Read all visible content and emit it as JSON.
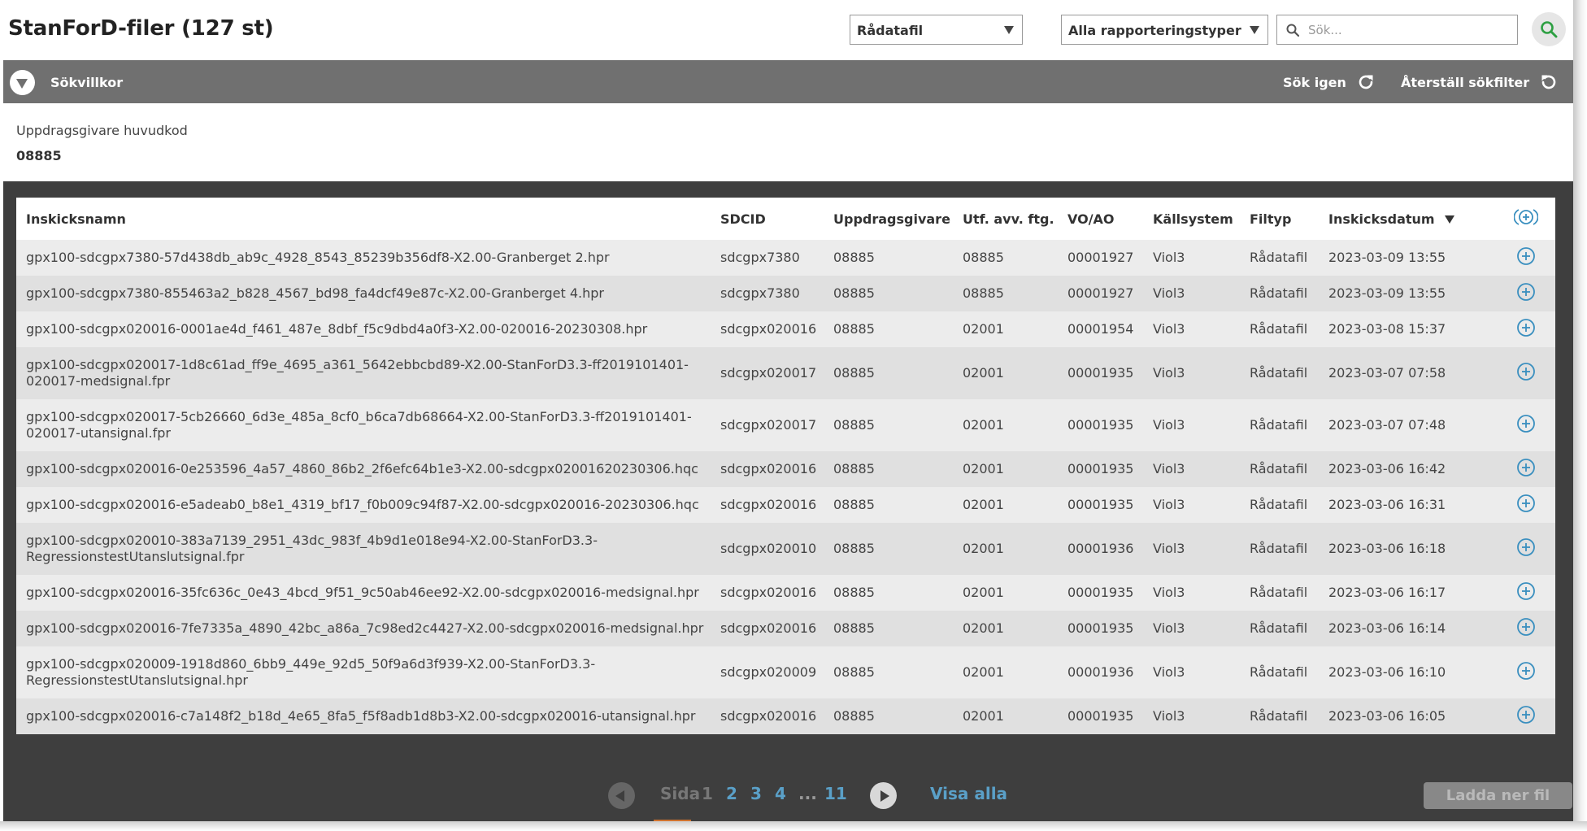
{
  "header": {
    "title": "StanForD-filer (127 st)",
    "file_type_select": "Rådatafil",
    "report_type_select": "Alla rapporteringstyper",
    "search_placeholder": "Sök..."
  },
  "filter_bar": {
    "label": "Sökvillkor",
    "redo_label": "Sök igen",
    "reset_label": "Återställ sökfilter"
  },
  "criteria": {
    "label": "Uppdragsgivare huvudkod",
    "value": "08885"
  },
  "table": {
    "columns": [
      "Inskicksnamn",
      "SDCID",
      "Uppdragsgivare",
      "Utf. avv. ftg.",
      "VO/AO",
      "Källsystem",
      "Filtyp",
      "Inskicksdatum"
    ],
    "rows": [
      {
        "name": "gpx100-sdcgpx7380-57d438db_ab9c_4928_8543_85239b356df8-X2.00-Granberget 2.hpr",
        "sdcid": "sdcgpx7380",
        "client": "08885",
        "exec": "08885",
        "voao": "00001927",
        "source": "Viol3",
        "filetype": "Rådatafil",
        "date": "2023-03-09 13:55"
      },
      {
        "name": "gpx100-sdcgpx7380-855463a2_b828_4567_bd98_fa4dcf49e87c-X2.00-Granberget 4.hpr",
        "sdcid": "sdcgpx7380",
        "client": "08885",
        "exec": "08885",
        "voao": "00001927",
        "source": "Viol3",
        "filetype": "Rådatafil",
        "date": "2023-03-09 13:55"
      },
      {
        "name": "gpx100-sdcgpx020016-0001ae4d_f461_487e_8dbf_f5c9dbd4a0f3-X2.00-020016-20230308.hpr",
        "sdcid": "sdcgpx020016",
        "client": "08885",
        "exec": "02001",
        "voao": "00001954",
        "source": "Viol3",
        "filetype": "Rådatafil",
        "date": "2023-03-08 15:37"
      },
      {
        "name": "gpx100-sdcgpx020017-1d8c61ad_ff9e_4695_a361_5642ebbcbd89-X2.00-StanForD3.3-ff2019101401-020017-medsignal.fpr",
        "sdcid": "sdcgpx020017",
        "client": "08885",
        "exec": "02001",
        "voao": "00001935",
        "source": "Viol3",
        "filetype": "Rådatafil",
        "date": "2023-03-07 07:58"
      },
      {
        "name": "gpx100-sdcgpx020017-5cb26660_6d3e_485a_8cf0_b6ca7db68664-X2.00-StanForD3.3-ff2019101401-020017-utansignal.fpr",
        "sdcid": "sdcgpx020017",
        "client": "08885",
        "exec": "02001",
        "voao": "00001935",
        "source": "Viol3",
        "filetype": "Rådatafil",
        "date": "2023-03-07 07:48"
      },
      {
        "name": "gpx100-sdcgpx020016-0e253596_4a57_4860_86b2_2f6efc64b1e3-X2.00-sdcgpx02001620230306.hqc",
        "sdcid": "sdcgpx020016",
        "client": "08885",
        "exec": "02001",
        "voao": "00001935",
        "source": "Viol3",
        "filetype": "Rådatafil",
        "date": "2023-03-06 16:42"
      },
      {
        "name": "gpx100-sdcgpx020016-e5adeab0_b8e1_4319_bf17_f0b009c94f87-X2.00-sdcgpx020016-20230306.hqc",
        "sdcid": "sdcgpx020016",
        "client": "08885",
        "exec": "02001",
        "voao": "00001935",
        "source": "Viol3",
        "filetype": "Rådatafil",
        "date": "2023-03-06 16:31"
      },
      {
        "name": "gpx100-sdcgpx020010-383a7139_2951_43dc_983f_4b9d1e018e94-X2.00-StanForD3.3-RegressionstestUtanslutsignal.fpr",
        "sdcid": "sdcgpx020010",
        "client": "08885",
        "exec": "02001",
        "voao": "00001936",
        "source": "Viol3",
        "filetype": "Rådatafil",
        "date": "2023-03-06 16:18"
      },
      {
        "name": "gpx100-sdcgpx020016-35fc636c_0e43_4bcd_9f51_9c50ab46ee92-X2.00-sdcgpx020016-medsignal.hpr",
        "sdcid": "sdcgpx020016",
        "client": "08885",
        "exec": "02001",
        "voao": "00001935",
        "source": "Viol3",
        "filetype": "Rådatafil",
        "date": "2023-03-06 16:17"
      },
      {
        "name": "gpx100-sdcgpx020016-7fe7335a_4890_42bc_a86a_7c98ed2c4427-X2.00-sdcgpx020016-medsignal.hpr",
        "sdcid": "sdcgpx020016",
        "client": "08885",
        "exec": "02001",
        "voao": "00001935",
        "source": "Viol3",
        "filetype": "Rådatafil",
        "date": "2023-03-06 16:14"
      },
      {
        "name": "gpx100-sdcgpx020009-1918d860_6bb9_449e_92d5_50f9a6d3f939-X2.00-StanForD3.3-RegressionstestUtanslutsignal.hpr",
        "sdcid": "sdcgpx020009",
        "client": "08885",
        "exec": "02001",
        "voao": "00001936",
        "source": "Viol3",
        "filetype": "Rådatafil",
        "date": "2023-03-06 16:10"
      },
      {
        "name": "gpx100-sdcgpx020016-c7a148f2_b18d_4e65_8fa5_f5f8adb1d8b3-X2.00-sdcgpx020016-utansignal.hpr",
        "sdcid": "sdcgpx020016",
        "client": "08885",
        "exec": "02001",
        "voao": "00001935",
        "source": "Viol3",
        "filetype": "Rådatafil",
        "date": "2023-03-06 16:05"
      }
    ]
  },
  "pagination": {
    "label": "Sida",
    "current": "1",
    "pages": [
      "2",
      "3",
      "4"
    ],
    "ellipsis": "...",
    "last": "11",
    "show_all": "Visa alla"
  },
  "actions": {
    "download_label": "Ladda ner fil"
  },
  "colors": {
    "accent_link": "#5aa0c8",
    "filter_bar": "#707070",
    "dark_bg": "#3e3e3e",
    "search_icon": "#2ea043",
    "plus_icon": "#3a8fbf"
  },
  "icons": {
    "search": "search-icon",
    "redo": "refresh-icon",
    "reset": "undo-icon",
    "add_column": "add-column-icon",
    "row_add": "plus-circle-icon"
  }
}
